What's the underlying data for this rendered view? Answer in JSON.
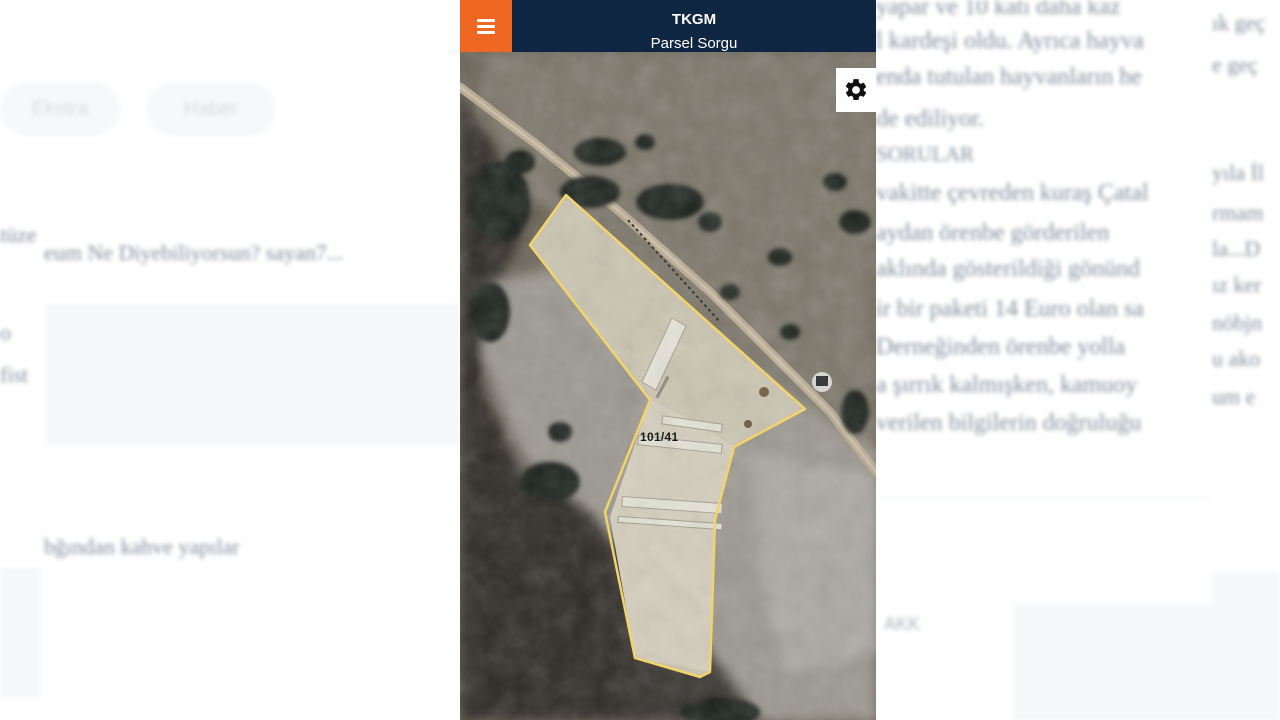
{
  "app": {
    "title": "TKGM",
    "subtitle": "Parsel Sorgu"
  },
  "map": {
    "parcel_label": "101/41",
    "parcel_outline_color": "#f1d46a"
  },
  "icons": {
    "menu": "hamburger-icon",
    "settings": "gear-icon"
  },
  "colors": {
    "app_bar": "#0f2642",
    "menu_button": "#ee6723"
  },
  "background_article": {
    "right_lines": [
      "yapar ve 10 katı daha kaz",
      "l kardeşi oldu. Ayrıca hayva",
      "enda tutulan hayvanların he",
      "de ediliyor.",
      "SORULAR",
      "vakitte çevreden kuraş Çatal",
      "aydan örenbe görderilen",
      "aklında gösterildiği gönünd",
      "ir bir paketi 14 Euro olan sa",
      "Derneğinden örenbe yolla",
      "a şırrık kalmışken, kamuoy",
      "verilen bilgilerin doğruluğu"
    ],
    "left_lines": [
      "eum Ne Diyebiliyorsun? sayan7...",
      "bğından kahve yapılar"
    ],
    "left_edge": [
      "tüze",
      "o",
      "fist"
    ],
    "pills": [
      "Ekstra",
      "Haber"
    ],
    "far_right": [
      "ık geç",
      "e geç",
      "yıla İl",
      "rmam",
      "la...D",
      "ız ker",
      "nöbjn",
      "u ako",
      "um e"
    ],
    "bottom_caption": "AKK"
  }
}
